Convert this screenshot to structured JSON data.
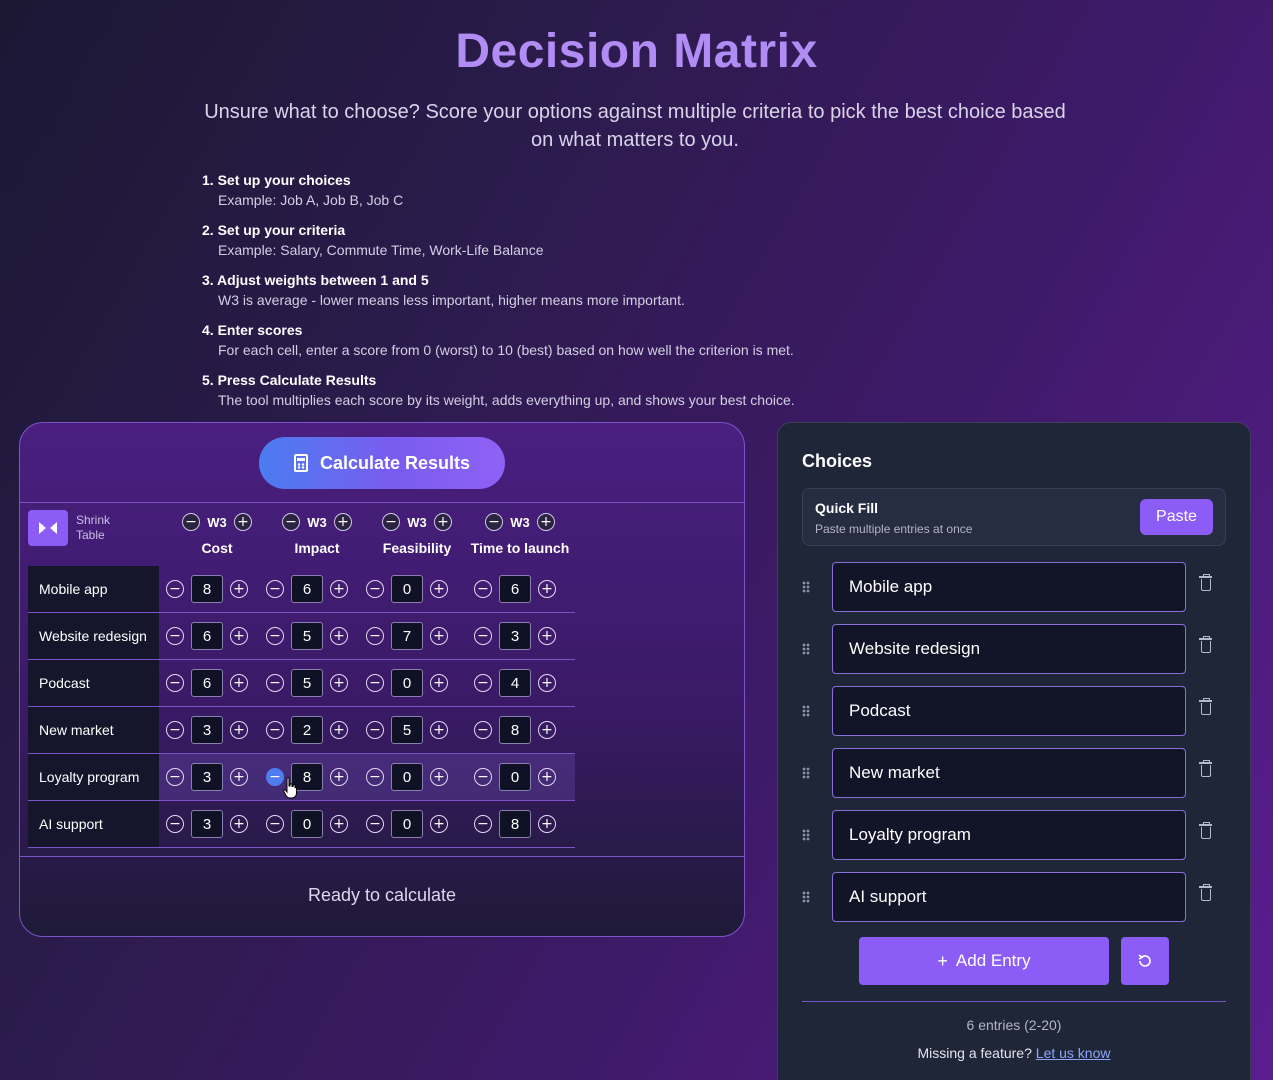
{
  "header": {
    "title": "Decision Matrix",
    "subtitle": "Unsure what to choose? Score your options against multiple criteria to pick the best choice based on what matters to you."
  },
  "steps": [
    {
      "title": "1. Set up your choices",
      "desc": "Example: Job A, Job B, Job C"
    },
    {
      "title": "2. Set up your criteria",
      "desc": "Example: Salary, Commute Time, Work-Life Balance"
    },
    {
      "title": "3. Adjust weights between 1 and 5",
      "desc": "W3 is average - lower means less important, higher means more important."
    },
    {
      "title": "4. Enter scores",
      "desc": "For each cell, enter a score from 0 (worst) to 10 (best) based on how well the criterion is met."
    },
    {
      "title": "5. Press Calculate Results",
      "desc": "The tool multiplies each score by its weight, adds everything up, and shows your best choice."
    }
  ],
  "matrix": {
    "calculate_label": "Calculate Results",
    "shrink_label_1": "Shrink",
    "shrink_label_2": "Table",
    "criteria": [
      {
        "name": "Cost",
        "weight": "W3"
      },
      {
        "name": "Impact",
        "weight": "W3"
      },
      {
        "name": "Feasibility",
        "weight": "W3"
      },
      {
        "name": "Time to launch",
        "weight": "W3"
      }
    ],
    "rows": [
      {
        "label": "Mobile app",
        "scores": [
          "8",
          "6",
          "0",
          "6"
        ]
      },
      {
        "label": "Website redesign",
        "scores": [
          "6",
          "5",
          "7",
          "3"
        ]
      },
      {
        "label": "Podcast",
        "scores": [
          "6",
          "5",
          "0",
          "4"
        ]
      },
      {
        "label": "New market",
        "scores": [
          "3",
          "2",
          "5",
          "8"
        ]
      },
      {
        "label": "Loyalty program",
        "scores": [
          "3",
          "8",
          "0",
          "0"
        ]
      },
      {
        "label": "AI support",
        "scores": [
          "3",
          "0",
          "0",
          "8"
        ]
      }
    ],
    "status": "Ready to calculate"
  },
  "choices": {
    "title": "Choices",
    "quick_fill_title": "Quick Fill",
    "quick_fill_sub": "Paste multiple entries at once",
    "paste_label": "Paste",
    "entries": [
      "Mobile app",
      "Website redesign",
      "Podcast",
      "New market",
      "Loyalty program",
      "AI support"
    ],
    "add_label": "Add Entry",
    "count_text": "6 entries  (2-20)",
    "feedback_text": "Missing a feature?",
    "feedback_link": "Let us know"
  },
  "colors": {
    "accent": "#8b5cf6",
    "title": "#b18cf5",
    "border": "#7b54c9"
  }
}
